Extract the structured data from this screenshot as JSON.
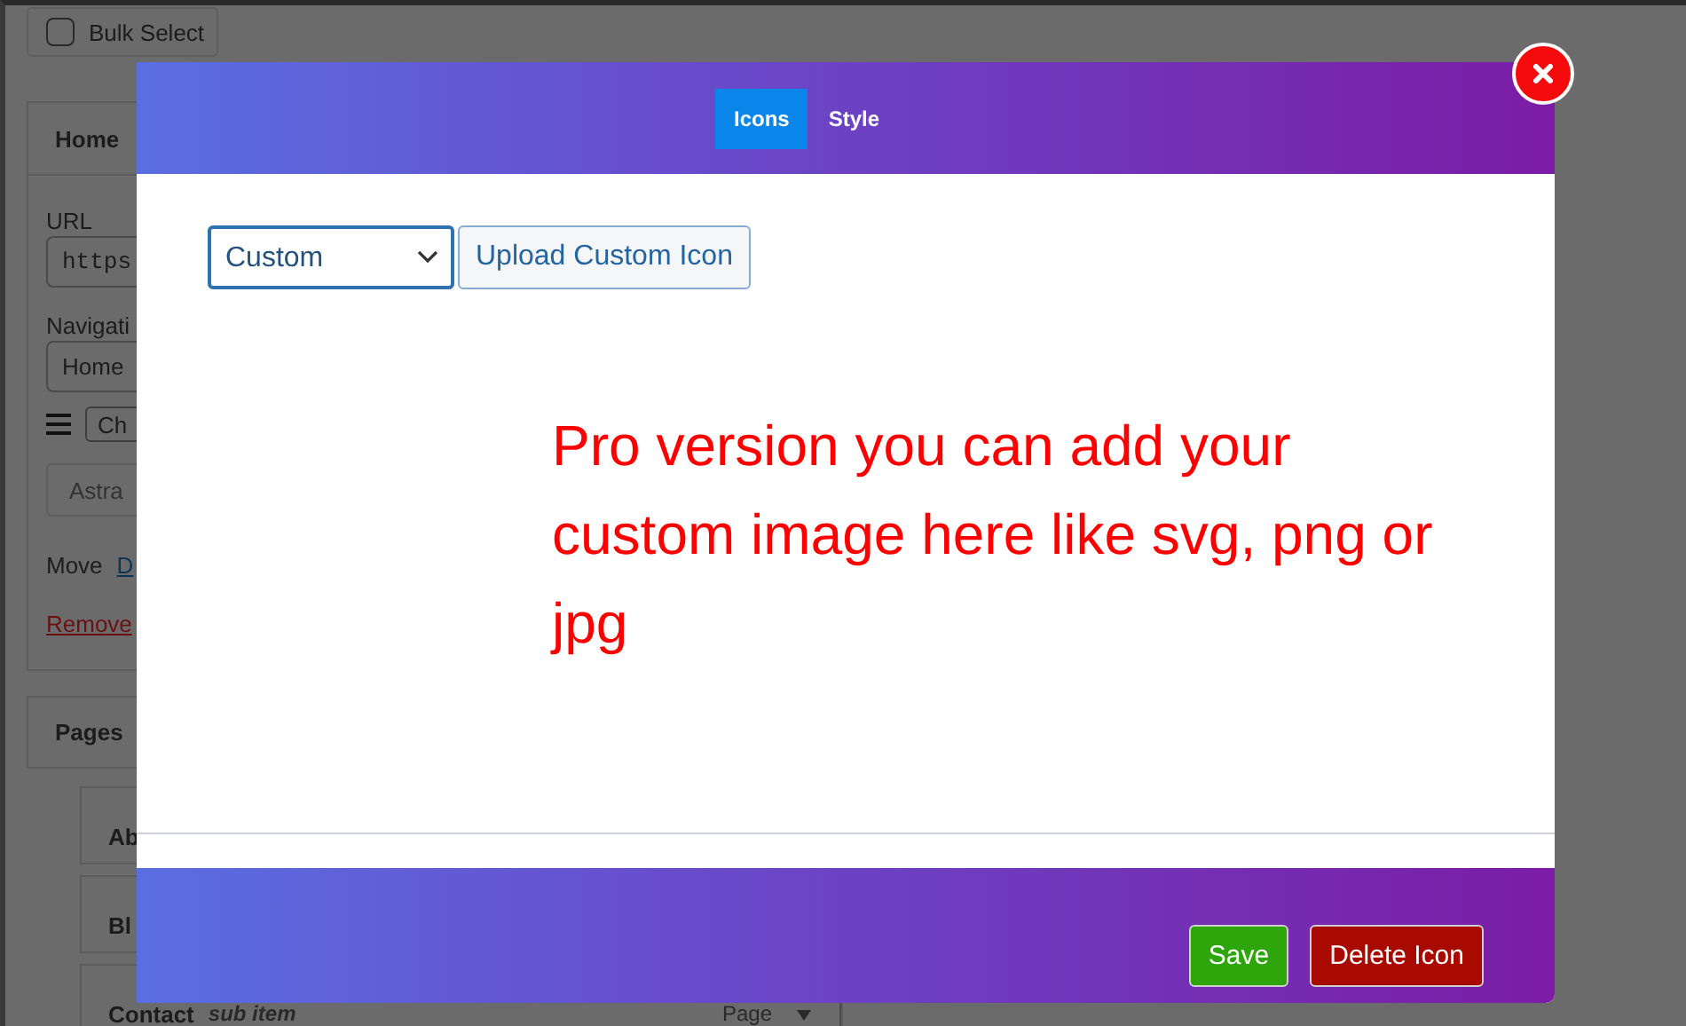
{
  "bulk_select": {
    "label": "Bulk Select",
    "checked": false
  },
  "menu_item": {
    "title": "Home",
    "url_label": "URL",
    "url_value": "https",
    "nav_label": "Navigati",
    "nav_value": "Home",
    "order_value": "Ch",
    "astra_button": "Astra",
    "move_label": "Move",
    "move_link": "D",
    "remove_link": "Remove"
  },
  "pages": {
    "title": "Pages",
    "items": [
      {
        "title": "Ab"
      },
      {
        "title": "Bl"
      },
      {
        "title": "Contact",
        "note": "sub item",
        "type": "Page"
      }
    ]
  },
  "modal": {
    "tabs": [
      {
        "label": "Icons",
        "selected": true
      },
      {
        "label": "Style",
        "selected": false
      }
    ],
    "icon_type": "Custom",
    "upload_button": "Upload Custom Icon",
    "notice": "Pro version you can add your custom image here like svg, png or jpg",
    "buttons": [
      {
        "label": "Save",
        "kind": "save"
      },
      {
        "label": "Delete Icon",
        "kind": "delete"
      }
    ]
  }
}
